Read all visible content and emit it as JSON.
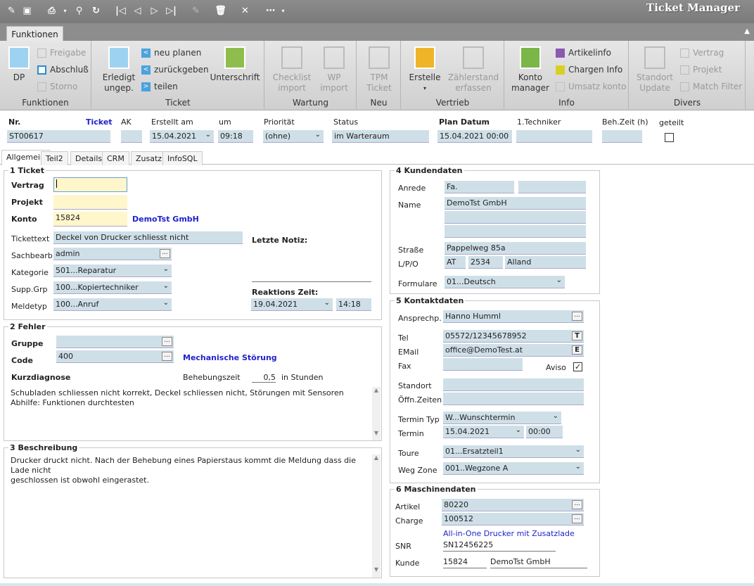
{
  "app": {
    "title": "Ticket Manager"
  },
  "ribbon": {
    "tab": "Funktionen",
    "groups": {
      "funktionen": "Funktionen",
      "ticket": "Ticket",
      "wartung": "Wartung",
      "neu": "Neu",
      "vertrieb": "Vertrieb",
      "info": "Info",
      "divers": "Divers"
    },
    "buttons": {
      "dp": "DP",
      "freigabe": "Freigabe",
      "abschluss": "Abschluß",
      "storno": "Storno",
      "erledigt": "Erledigt\nungep.",
      "neu_planen": "neu planen",
      "zurueckgeben": "zurückgeben",
      "teilen": "teilen",
      "unterschrift": "Unterschrift",
      "checklist": "Checklist\nimport",
      "wp_import": "WP\nimport",
      "tpm_ticket": "TPM\nTicket",
      "erstelle": "Erstelle",
      "zaehlerstand": "Zählerstand\nerfassen",
      "konto_manager": "Konto\nmanager",
      "artikelinfo": "Artikelinfo",
      "chargen_info": "Chargen Info",
      "umsatz_konto": "Umsatz konto",
      "standort_update": "Standort\nUpdate",
      "vertrag": "Vertrag",
      "projekt": "Projekt",
      "match_filter": "Match Filter"
    }
  },
  "header": {
    "nr_label": "Nr.",
    "ticket_label": "Ticket",
    "nr_value": "ST00617",
    "ak_label": "AK",
    "erstellt_label": "Erstellt am",
    "erstellt_value": "15.04.2021",
    "um_label": "um",
    "um_value": "09:18",
    "prioritaet_label": "Priorität",
    "prioritaet_value": "(ohne)",
    "status_label": "Status",
    "status_value": "im Warteraum",
    "plan_label": "Plan Datum",
    "plan_value": "15.04.2021 00:00",
    "techniker_label": "1.Techniker",
    "behzeit_label": "Beh.Zeit (h)",
    "geteilt_label": "geteilt"
  },
  "tabs": [
    "Allgemein",
    "Teil2",
    "Details",
    "CRM",
    "Zusatz",
    "InfoSQL"
  ],
  "ticket": {
    "title": "1 Ticket",
    "vertrag_label": "Vertrag",
    "projekt_label": "Projekt",
    "konto_label": "Konto",
    "konto_value": "15824",
    "konto_name": "DemoTst GmbH",
    "tickettext_label": "Tickettext",
    "tickettext_value": "Deckel von Drucker schliesst nicht",
    "letzte_notiz_label": "Letzte Notiz:",
    "sachbearb_label": "Sachbearb.",
    "sachbearb_value": "admin",
    "kategorie_label": "Kategorie",
    "kategorie_value": "501...Reparatur",
    "suppgrp_label": "Supp.Grp",
    "suppgrp_value": "100...Kopiertechniker",
    "meldetyp_label": "Meldetyp",
    "meldetyp_value": "100...Anruf",
    "reaktion_label": "Reaktions Zeit:",
    "reaktion_date": "19.04.2021",
    "reaktion_time": "14:18"
  },
  "fehler": {
    "title": "2 Fehler",
    "gruppe_label": "Gruppe",
    "code_label": "Code",
    "code_value": "400",
    "code_name": "Mechanische Störung",
    "kurzdiagnose_label": "Kurzdiagnose",
    "behebungszeit_label": "Behebungszeit",
    "behebungszeit_value": "0,5",
    "stunden_label": "in Stunden",
    "text": "Schubladen schliessen nicht korrekt, Deckel schliessen nicht, Störungen mit Sensoren\nAbhilfe: Funktionen durchtesten"
  },
  "beschreibung": {
    "title": "3 Beschreibung",
    "text": "Drucker druckt nicht. Nach der Behebung eines Papierstaus kommt die Meldung dass die Lade nicht\ngeschlossen ist obwohl eingerastet."
  },
  "kunde": {
    "title": "4 Kundendaten",
    "anrede_label": "Anrede",
    "anrede_value": "Fa.",
    "name_label": "Name",
    "name_value": "DemoTst GmbH",
    "strasse_label": "Straße",
    "strasse_value": "Pappelweg 85a",
    "lpo_label": "L/P/O",
    "land": "AT",
    "plz": "2534",
    "ort": "Alland",
    "formulare_label": "Formulare",
    "formulare_value": "01...Deutsch"
  },
  "kontakt": {
    "title": "5 Kontaktdaten",
    "ansprech_label": "Ansprechp.",
    "ansprech_value": "Hanno Humml",
    "tel_label": "Tel",
    "tel_value": "05572/12345678952",
    "tel_btn": "T",
    "email_label": "EMail",
    "email_value": "office@DemoTest.at",
    "email_btn": "E",
    "fax_label": "Fax",
    "aviso_label": "Aviso",
    "standort_label": "Standort",
    "oeffn_label": "Öffn.Zeiten",
    "termintyp_label": "Termin Typ",
    "termintyp_value": "W...Wunschtermin",
    "termin_label": "Termin",
    "termin_date": "15.04.2021",
    "termin_time": "00:00",
    "toure_label": "Toure",
    "toure_value": "01...Ersatzteil1",
    "wegzone_label": "Weg Zone",
    "wegzone_value": "001..Wegzone A"
  },
  "maschine": {
    "title": "6 Maschinendaten",
    "artikel_label": "Artikel",
    "artikel_value": "80220",
    "charge_label": "Charge",
    "charge_value": "100512",
    "beschreibung": "All-in-One Drucker mit Zusatzlade",
    "snr_label": "SNR",
    "snr_value": "SN12456225",
    "kunde_label": "Kunde",
    "kunde_nr": "15824",
    "kunde_name": "DemoTst GmbH"
  }
}
